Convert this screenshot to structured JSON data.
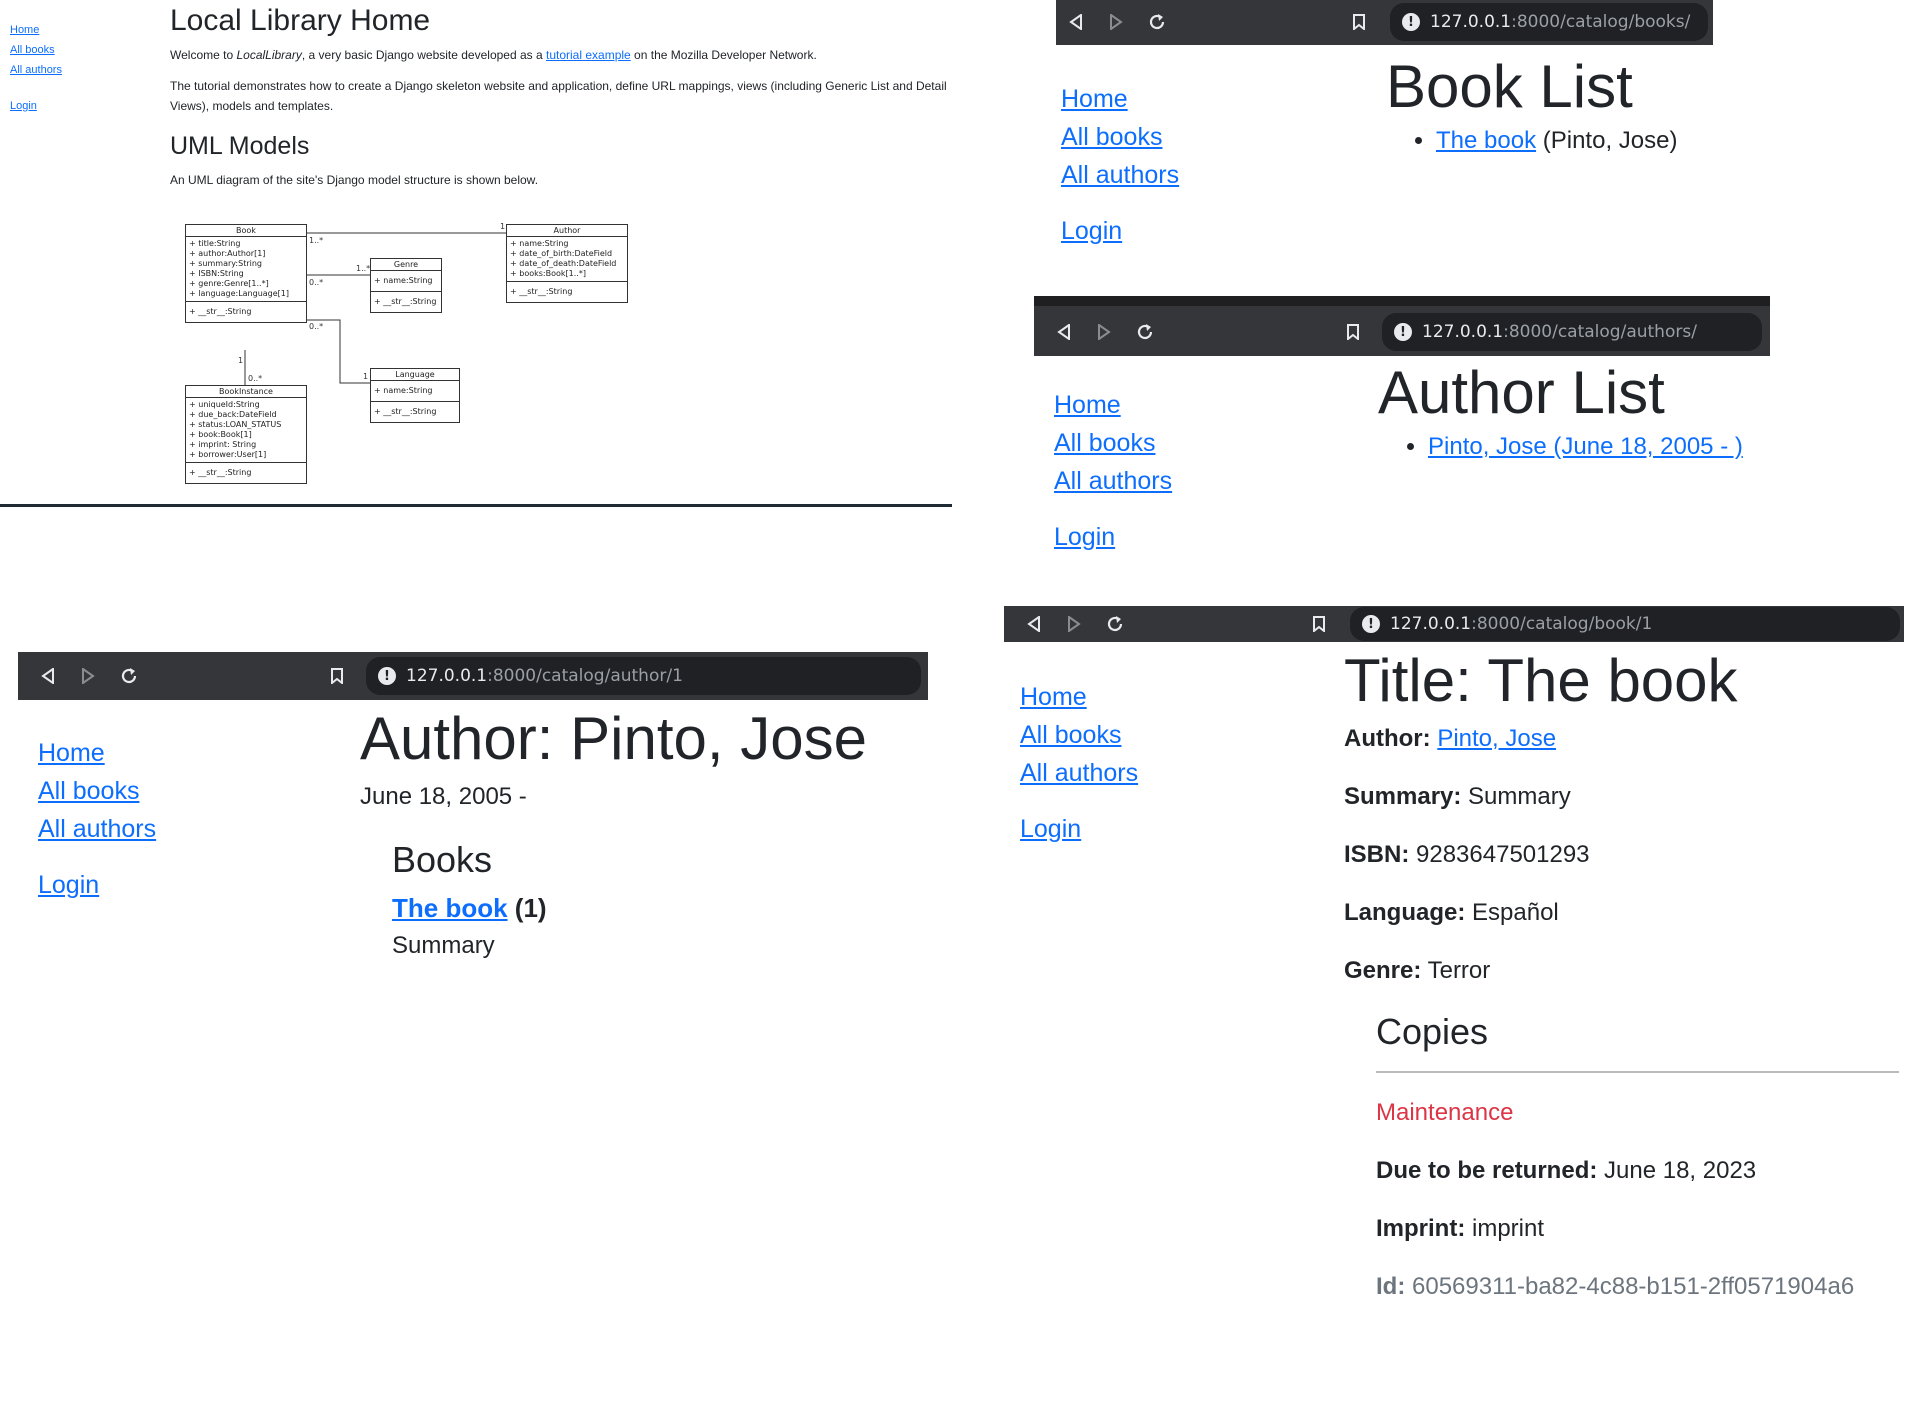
{
  "home": {
    "side": [
      "Home",
      "All books",
      "All authors",
      "Login"
    ],
    "title": "Local Library Home",
    "p1_pre": "Welcome to ",
    "p1_em": "LocalLibrary",
    "p1_mid": ", a very basic Django website developed as a ",
    "p1_link": "tutorial example",
    "p1_post": " on the Mozilla Developer Network.",
    "p2": "The tutorial demonstrates how to create a Django skeleton website and application, define URL mappings, views (including Generic List and Detail Views), models and templates.",
    "h2": "UML Models",
    "p3": "An UML diagram of the site's Django model structure is shown below.",
    "uml": {
      "book": {
        "name": "Book",
        "attrs": [
          "+ title:String",
          "+ author:Author[1]",
          "+ summary:String",
          "+ ISBN:String",
          "+ genre:Genre[1..*]",
          "+ language:Language[1]"
        ],
        "ops": [
          "+ __str__:String"
        ]
      },
      "genre": {
        "name": "Genre",
        "attrs": [
          "+ name:String"
        ],
        "ops": [
          "+ __str__:String"
        ]
      },
      "author": {
        "name": "Author",
        "attrs": [
          "+ name:String",
          "+ date_of_birth:DateField",
          "+ date_of_death:DateField",
          "+ books:Book[1..*]"
        ],
        "ops": [
          "+ __str__:String"
        ]
      },
      "language": {
        "name": "Language",
        "attrs": [
          "+ name:String"
        ],
        "ops": [
          "+ __str__:String"
        ]
      },
      "bookinstance": {
        "name": "BookInstance",
        "attrs": [
          "+ uniqueId:String",
          "+ due_back:DateField",
          "+ status:LOAN_STATUS",
          "+ book:Book[1]",
          "+ imprint: String",
          "+ borrower:User[1]"
        ],
        "ops": [
          "+ __str__:String"
        ]
      },
      "mult": [
        "1..*",
        "1",
        "1..*",
        "0..*",
        "0..*",
        "1",
        "1",
        "0..*"
      ]
    }
  },
  "nav": [
    "Home",
    "All books",
    "All authors",
    "Login"
  ],
  "books_page": {
    "url_host": "127.0.0.1",
    "url_path": ":8000/catalog/books/",
    "title": "Book List",
    "item_link": "The book",
    "item_rest": " (Pinto, Jose)"
  },
  "authors_page": {
    "url_host": "127.0.0.1",
    "url_path": ":8000/catalog/authors/",
    "title": "Author List",
    "item_link": "Pinto, Jose (June 18, 2005 - )"
  },
  "author_page": {
    "url_host": "127.0.0.1",
    "url_path": ":8000/catalog/author/1",
    "title": "Author: Pinto, Jose",
    "dates": "June 18, 2005 -",
    "books_heading": "Books",
    "book_link": "The book",
    "book_count": " (1)",
    "book_summary": "Summary"
  },
  "book_page": {
    "url_host": "127.0.0.1",
    "url_path": ":8000/catalog/book/1",
    "title": "Title: The book",
    "author_label": "Author:",
    "author_value": "Pinto, Jose",
    "summary_label": "Summary:",
    "summary_value": " Summary",
    "isbn_label": "ISBN:",
    "isbn_value": " 9283647501293",
    "language_label": "Language:",
    "language_value": " Español",
    "genre_label": "Genre:",
    "genre_value": " Terror",
    "copies_heading": "Copies",
    "status": "Maintenance",
    "due_label": "Due to be returned:",
    "due_value": " June 18, 2023",
    "imprint_label": "Imprint:",
    "imprint_value": " imprint",
    "id_label": "Id:",
    "id_value": " 60569311-ba82-4c88-b151-2ff0571904a6"
  },
  "colors": {
    "link": "#0d6efd",
    "chrome": "#35363a",
    "urlbar": "#202124",
    "danger": "#dc3545",
    "muted": "#6c757d"
  },
  "icons": [
    "back-icon",
    "forward-icon",
    "reload-icon",
    "bookmark-icon",
    "info-icon"
  ]
}
